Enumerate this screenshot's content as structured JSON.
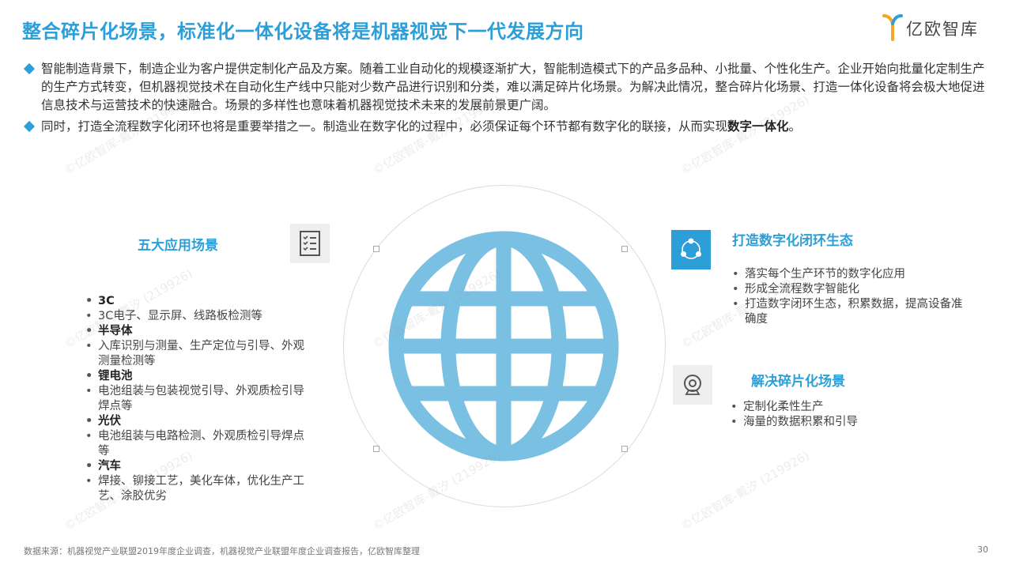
{
  "header": {
    "title": "整合碎片化场景，标准化一体化设备将是机器视觉下一代发展方向",
    "logo_text": "亿欧智库"
  },
  "intro": [
    {
      "text": "智能制造背景下，制造企业为客户提供定制化产品及方案。随着工业自动化的规模逐渐扩大，智能制造模式下的产品多品种、小批量、个性化生产。企业开始向批量化定制生产的生产方式转变，但机器视觉技术在自动化生产线中只能对少数产品进行识别和分类，难以满足碎片化场景。为解决此情况，整合碎片化场景、打造一体化设备将会极大地促进信息技术与运营技术的快速融合。场景的多样性也意味着机器视觉技术未来的发展前景更广阔。"
    },
    {
      "text": "同时，打造全流程数字化闭环也将是重要举措之一。制造业在数字化的过程中，必须保证每个环节都有数字化的联接，从而实现",
      "bold": "数字一体化",
      "end": "。"
    }
  ],
  "left_panel": {
    "title": "五大应用场景",
    "icon": "checklist-icon",
    "items": [
      {
        "cat": "3C",
        "desc": "3C电子、显示屏、线路板检测等"
      },
      {
        "cat": "半导体",
        "desc": "入库识别与测量、生产定位与引导、外观测量检测等"
      },
      {
        "cat": "锂电池",
        "desc": "电池组装与包装视觉引导、外观质检引导焊点等"
      },
      {
        "cat": "光伏",
        "desc": "电池组装与电路检测、外观质检引导焊点等"
      },
      {
        "cat": "汽车",
        "desc": "焊接、铆接工艺，美化车体，优化生产工艺、涂胶优劣"
      }
    ]
  },
  "right_top": {
    "title": "打造数字化闭环生态",
    "icon": "share-cycle-icon",
    "items": [
      "落实每个生产环节的数字化应用",
      "形成全流程数字智能化",
      "打造数字闭环生态，积累数据，提高设备准确度"
    ]
  },
  "right_bottom": {
    "title": "解决碎片化场景",
    "icon": "camera-icon",
    "items": [
      "定制化柔性生产",
      "海量的数据积累和引导"
    ]
  },
  "center": {
    "icon": "globe-icon"
  },
  "footer": {
    "source": "数据来源：机器视觉产业联盟2019年度企业调查，机器视觉产业联盟年度企业调查报告，亿欧智库整理",
    "page": "30"
  },
  "watermark": "©亿欧智库-戴汐 (219926)",
  "colors": {
    "accent": "#2c9fd8",
    "globe": "#79c0e2"
  }
}
